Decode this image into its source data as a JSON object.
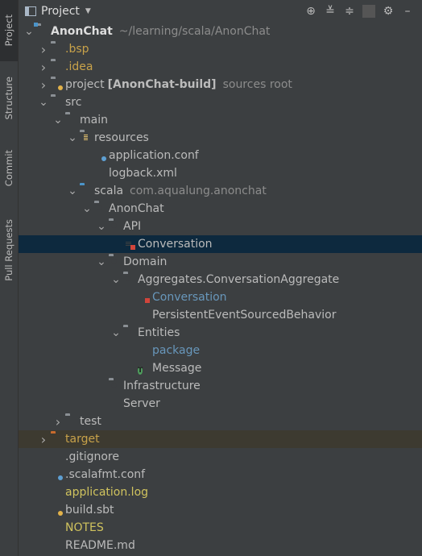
{
  "strip": {
    "tabs": [
      {
        "label": "Project",
        "icon": "folder-icon",
        "active": true
      },
      {
        "label": "Structure",
        "icon": "structure-icon",
        "active": false
      },
      {
        "label": "Commit",
        "icon": "commit-icon",
        "active": false
      },
      {
        "label": "Pull Requests",
        "icon": "pull-request-icon",
        "active": false
      }
    ]
  },
  "header": {
    "title": "Project",
    "tools": [
      "target-icon",
      "expand-all-icon",
      "collapse-all-icon",
      "gear-icon",
      "hide-icon"
    ]
  },
  "tree": [
    {
      "name": "anonchat",
      "depth": 0,
      "chev": "down",
      "icon": "module",
      "label": "AnonChat",
      "style": "bold",
      "extra": "~/learning/scala/AnonChat"
    },
    {
      "name": "bsp",
      "depth": 1,
      "chev": "right",
      "icon": "folder",
      "label": ".bsp",
      "style": "excl"
    },
    {
      "name": "idea",
      "depth": 1,
      "chev": "right",
      "icon": "folder",
      "label": ".idea",
      "style": "excl"
    },
    {
      "name": "project",
      "depth": 1,
      "chev": "right",
      "icon": "folder-dot",
      "label": "project",
      "module": "[AnonChat-build]",
      "extra": "sources root"
    },
    {
      "name": "src",
      "depth": 1,
      "chev": "down",
      "icon": "folder",
      "label": "src"
    },
    {
      "name": "main",
      "depth": 2,
      "chev": "down",
      "icon": "folder",
      "label": "main"
    },
    {
      "name": "resources",
      "depth": 3,
      "chev": "down",
      "icon": "resources",
      "label": "resources"
    },
    {
      "name": "application-conf",
      "depth": 4,
      "chev": "none",
      "icon": "conf",
      "label": "application.conf"
    },
    {
      "name": "logback-xml",
      "depth": 4,
      "chev": "none",
      "icon": "xml",
      "label": "logback.xml"
    },
    {
      "name": "scala",
      "depth": 3,
      "chev": "down",
      "icon": "folder-blue",
      "label": "scala",
      "extra": "com.aqualung.anonchat"
    },
    {
      "name": "anonchat-pkg",
      "depth": 4,
      "chev": "down",
      "icon": "package",
      "label": "AnonChat"
    },
    {
      "name": "api",
      "depth": 5,
      "chev": "down",
      "icon": "package",
      "label": "API"
    },
    {
      "name": "conversation-api",
      "depth": 6,
      "chev": "none",
      "icon": "scala-file",
      "label": "Conversation",
      "selected": true
    },
    {
      "name": "domain",
      "depth": 5,
      "chev": "down",
      "icon": "package",
      "label": "Domain"
    },
    {
      "name": "aggregates",
      "depth": 6,
      "chev": "down",
      "icon": "package",
      "label": "Aggregates.ConversationAggregate"
    },
    {
      "name": "conversation-agg",
      "depth": 7,
      "chev": "none",
      "icon": "scala-file",
      "label": "Conversation",
      "style": "link"
    },
    {
      "name": "persistent-esb",
      "depth": 7,
      "chev": "none",
      "icon": "object",
      "label": "PersistentEventSourcedBehavior"
    },
    {
      "name": "entities",
      "depth": 6,
      "chev": "down",
      "icon": "package",
      "label": "Entities"
    },
    {
      "name": "package-obj",
      "depth": 7,
      "chev": "none",
      "icon": "pkg-object",
      "label": "package",
      "style": "link"
    },
    {
      "name": "message",
      "depth": 7,
      "chev": "none",
      "icon": "trait",
      "label": "Message"
    },
    {
      "name": "infrastructure",
      "depth": 5,
      "chev": "none",
      "icon": "package",
      "label": "Infrastructure"
    },
    {
      "name": "server",
      "depth": 5,
      "chev": "none",
      "icon": "object",
      "label": "Server"
    },
    {
      "name": "test",
      "depth": 2,
      "chev": "right",
      "icon": "folder",
      "label": "test"
    },
    {
      "name": "target",
      "depth": 1,
      "chev": "right",
      "icon": "folder-orange",
      "label": "target",
      "style": "excl",
      "excluded": true
    },
    {
      "name": "gitignore",
      "depth": 1,
      "chev": "none",
      "icon": "gitignore",
      "label": ".gitignore"
    },
    {
      "name": "scalafmt",
      "depth": 1,
      "chev": "none",
      "icon": "conf",
      "label": ".scalafmt.conf"
    },
    {
      "name": "application-log",
      "depth": 1,
      "chev": "none",
      "icon": "file",
      "label": "application.log",
      "style": "gitign"
    },
    {
      "name": "build-sbt",
      "depth": 1,
      "chev": "none",
      "icon": "sbt",
      "label": "build.sbt"
    },
    {
      "name": "notes",
      "depth": 1,
      "chev": "none",
      "icon": "file",
      "label": "NOTES",
      "style": "gitign"
    },
    {
      "name": "readme",
      "depth": 1,
      "chev": "none",
      "icon": "md",
      "label": "README.md"
    }
  ]
}
